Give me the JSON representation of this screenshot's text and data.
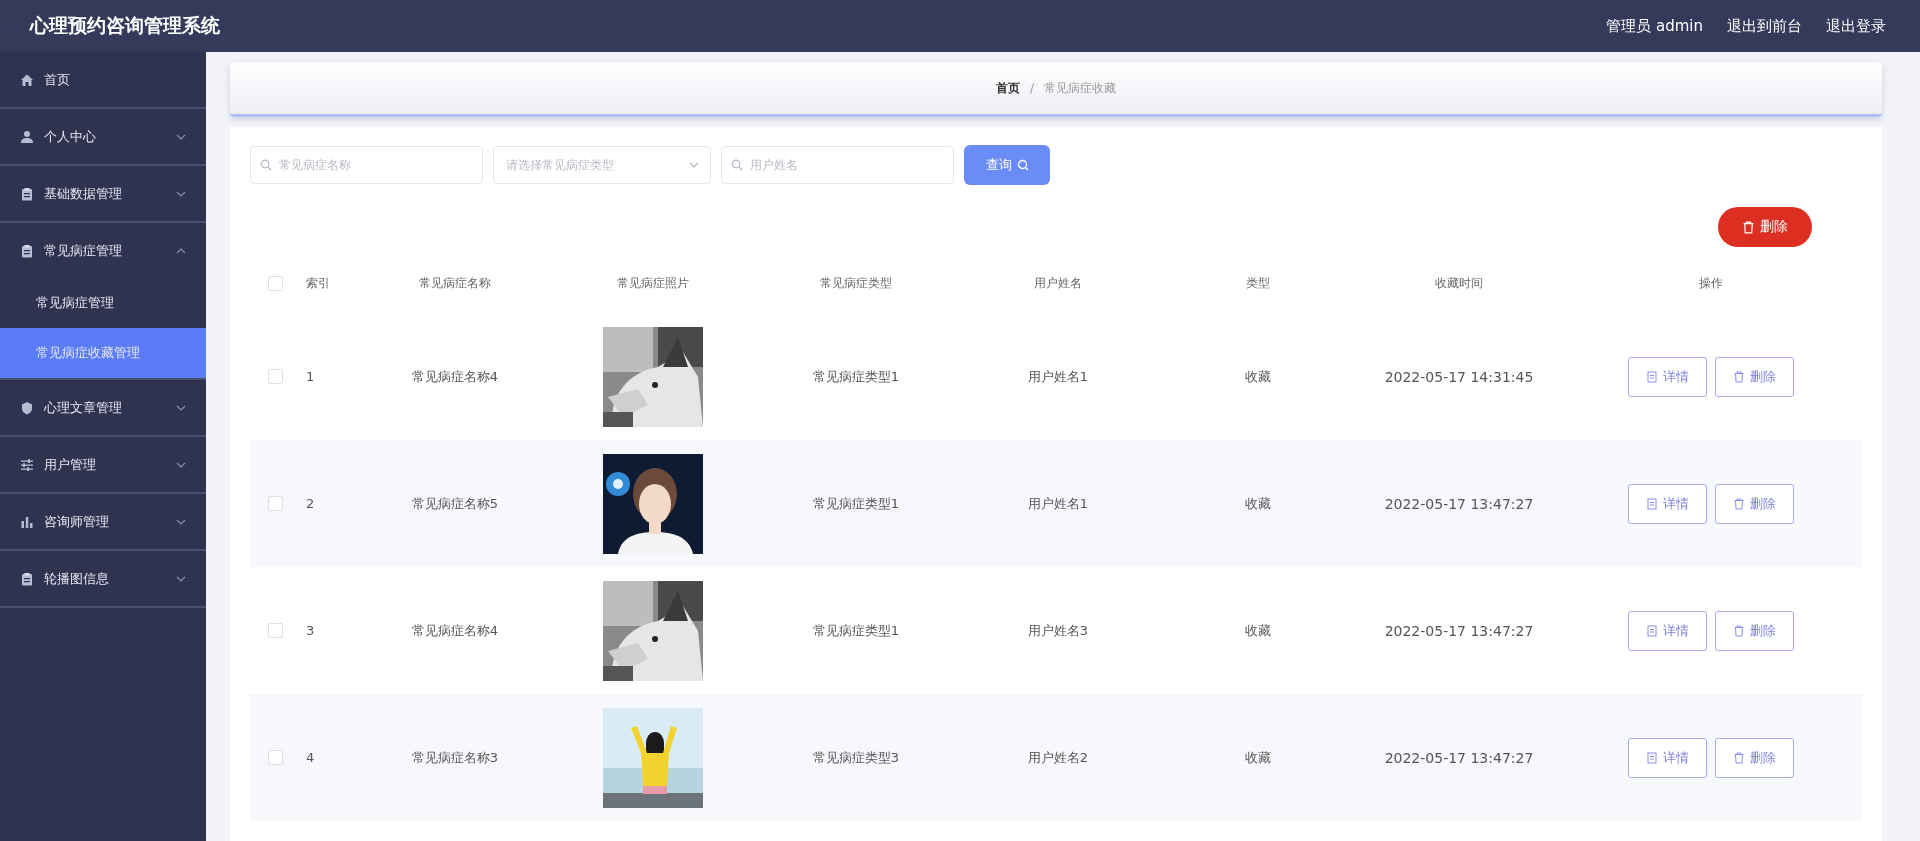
{
  "header": {
    "title": "心理预约咨询管理系统",
    "links": [
      "管理员 admin",
      "退出到前台",
      "退出登录"
    ]
  },
  "sidebar": {
    "items": [
      {
        "label": "首页",
        "has_arrow": false
      },
      {
        "label": "个人中心",
        "expanded": false,
        "has_arrow": true
      },
      {
        "label": "基础数据管理",
        "expanded": false,
        "has_arrow": true
      },
      {
        "label": "常见病症管理",
        "expanded": true,
        "has_arrow": true,
        "children": [
          {
            "label": "常见病症管理",
            "selected": false
          },
          {
            "label": "常见病症收藏管理",
            "selected": true
          }
        ]
      },
      {
        "label": "心理文章管理",
        "expanded": false,
        "has_arrow": true
      },
      {
        "label": "用户管理",
        "expanded": false,
        "has_arrow": true
      },
      {
        "label": "咨询师管理",
        "expanded": false,
        "has_arrow": true
      },
      {
        "label": "轮播图信息",
        "expanded": false,
        "has_arrow": true
      }
    ]
  },
  "breadcrumb": [
    "首页",
    "常见病症收藏"
  ],
  "breadcrumb_separator": "/",
  "search": {
    "name_placeholder": "常见病症名称",
    "type_placeholder": "请选择常见病症类型",
    "user_placeholder": "用户姓名",
    "button": "查询"
  },
  "bulk_delete": "删除",
  "table": {
    "all_checked": false,
    "columns": [
      "索引",
      "常见病症名称",
      "常见病症照片",
      "常见病症类型",
      "用户姓名",
      "类型",
      "收藏时间",
      "操作"
    ],
    "rows": [
      {
        "checked": false,
        "index": "1",
        "name": "常见病症名称4",
        "type": "常见病症类型1",
        "user": "用户姓名1",
        "kind": "收藏",
        "time": "2022-05-17 14:31:45",
        "actions": [
          "详情",
          "删除"
        ]
      },
      {
        "checked": false,
        "index": "2",
        "name": "常见病症名称5",
        "type": "常见病症类型1",
        "user": "用户姓名1",
        "kind": "收藏",
        "time": "2022-05-17 13:47:27",
        "actions": [
          "详情",
          "删除"
        ]
      },
      {
        "checked": false,
        "index": "3",
        "name": "常见病症名称4",
        "type": "常见病症类型1",
        "user": "用户姓名3",
        "kind": "收藏",
        "time": "2022-05-17 13:47:27",
        "actions": [
          "详情",
          "删除"
        ]
      },
      {
        "checked": false,
        "index": "4",
        "name": "常见病症名称3",
        "type": "常见病症类型3",
        "user": "用户姓名2",
        "kind": "收藏",
        "time": "2022-05-17 13:47:27",
        "actions": [
          "详情",
          "删除"
        ]
      }
    ]
  }
}
